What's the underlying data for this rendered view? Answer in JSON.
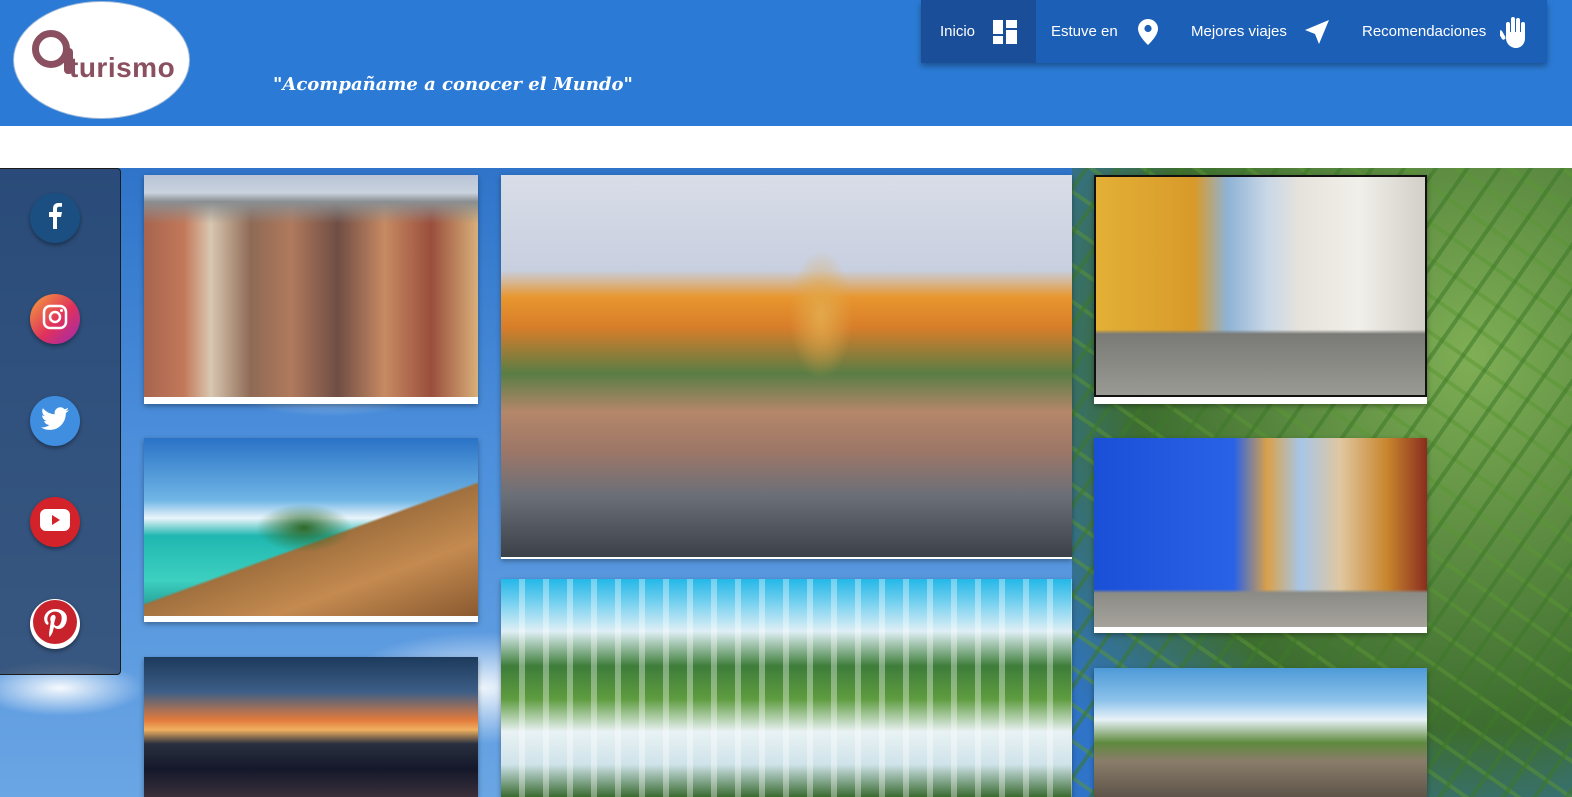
{
  "header": {
    "logo_text": "turismo",
    "tagline": "\"Acompañame a conocer el Mundo\""
  },
  "nav": {
    "items": [
      {
        "label": "Inicio",
        "icon": "dashboard-icon",
        "active": true
      },
      {
        "label": "Estuve en",
        "icon": "location-pin-icon",
        "active": false
      },
      {
        "label": "Mejores viajes",
        "icon": "send-arrow-icon",
        "active": false
      },
      {
        "label": "Recomendaciones",
        "icon": "hand-icon",
        "active": false
      }
    ]
  },
  "social": [
    {
      "network": "facebook",
      "icon": "facebook-icon",
      "color": "#1b4f82"
    },
    {
      "network": "instagram",
      "icon": "instagram-icon",
      "color": "#e0315c"
    },
    {
      "network": "twitter",
      "icon": "twitter-icon",
      "color": "#3f8ee0"
    },
    {
      "network": "youtube",
      "icon": "youtube-icon",
      "color": "#d3222a"
    },
    {
      "network": "pinterest",
      "icon": "pinterest-icon",
      "color": "#c8232c"
    }
  ],
  "gallery": {
    "left": [
      "photo-colonial-street-bogota",
      "photo-tropical-island-dock",
      "photo-city-sunset"
    ],
    "center": [
      "photo-cartagena-clock-tower",
      "photo-iguazu-falls"
    ],
    "right": [
      "photo-yellow-colonial-street",
      "photo-blue-colonial-houses",
      "photo-canyon-sky"
    ]
  },
  "colors": {
    "header_blue": "#2b7bd6",
    "nav_blue": "#1c5fb6",
    "logo_maroon": "#8a4f60"
  }
}
